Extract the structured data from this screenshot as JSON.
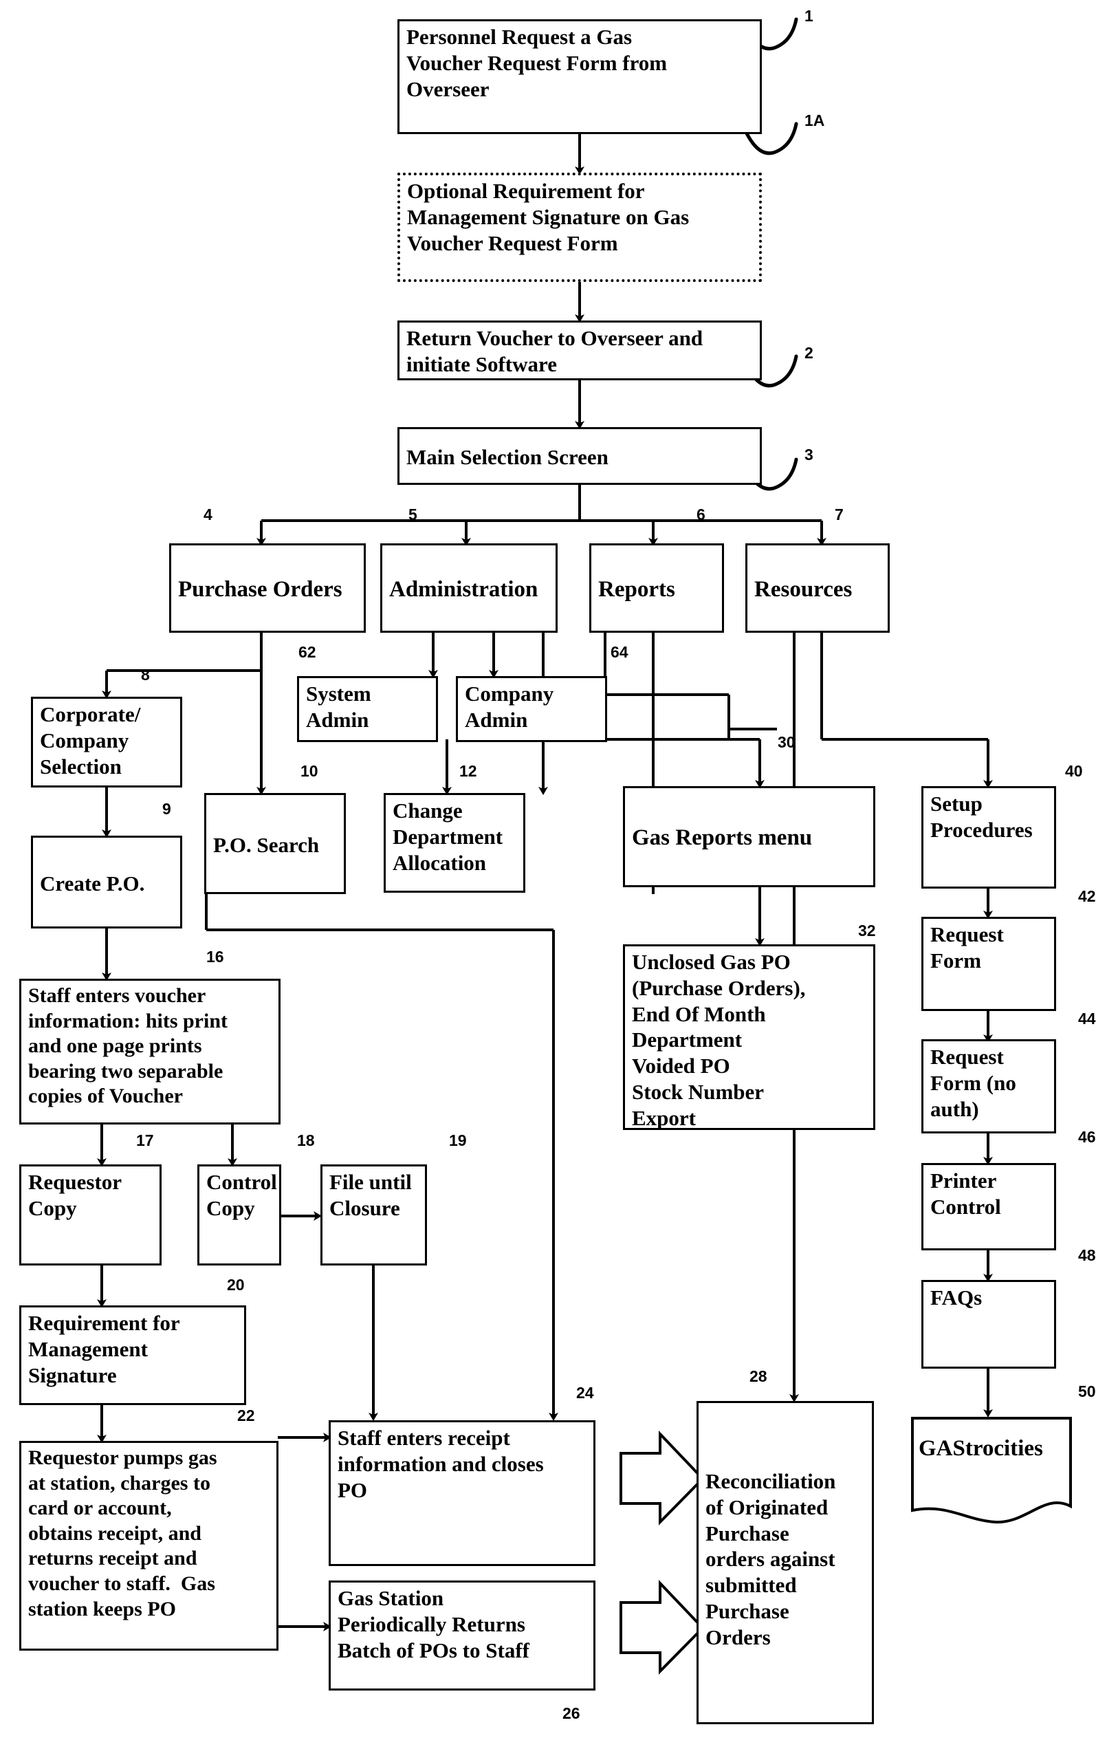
{
  "diagram": {
    "title": "Gas Voucher Purchase Order Process Flowchart",
    "type": "flowchart"
  },
  "nodes": {
    "n1": {
      "label": "Personnel Request a Gas Voucher Request Form from Overseer",
      "ref": "1"
    },
    "n1a": {
      "label": "Optional Requirement for Management Signature on Gas Voucher Request Form",
      "ref": "1A"
    },
    "n2": {
      "label": "Return Voucher to Overseer and initiate Software",
      "ref": "2"
    },
    "n3": {
      "label": "Main Selection Screen",
      "ref": "3"
    },
    "n4": {
      "label": "Purchase Orders",
      "ref": "4"
    },
    "n5": {
      "label": "Administration",
      "ref": "5"
    },
    "n6": {
      "label": "Reports",
      "ref": "6"
    },
    "n7": {
      "label": "Resources",
      "ref": "7"
    },
    "n8": {
      "label": "Corporate/ Company Selection",
      "ref": "8"
    },
    "n9": {
      "label": "Create P.O.",
      "ref": "9"
    },
    "n10": {
      "label": "P.O. Search",
      "ref": "10"
    },
    "n12": {
      "label": "Change Department Allocation",
      "ref": "12"
    },
    "n62": {
      "label": "System Admin",
      "ref": "62"
    },
    "n64": {
      "label": "Company Admin",
      "ref": "64"
    },
    "n16": {
      "label": "Staff enters voucher information: hits print and one page prints bearing two separable copies of Voucher",
      "ref": "16"
    },
    "n17": {
      "label": "Requestor Copy",
      "ref": "17"
    },
    "n18": {
      "label": "Control Copy",
      "ref": "18"
    },
    "n19": {
      "label": "File until Closure",
      "ref": "19"
    },
    "n20": {
      "label": "Requirement for Management Signature",
      "ref": "20"
    },
    "n22": {
      "label": "Requestor pumps gas at station, charges to card or account, obtains receipt, and returns receipt and voucher to staff.  Gas station keeps PO",
      "ref": "22"
    },
    "n24": {
      "label": "Staff enters receipt information and closes PO",
      "ref": "24"
    },
    "n26": {
      "label": "Gas Station Periodically Returns Batch of POs to Staff",
      "ref": "26"
    },
    "n28": {
      "label": "Reconciliation of Originated Purchase orders against submitted Purchase Orders",
      "ref": "28"
    },
    "n30": {
      "label": "Gas Reports menu",
      "ref": "30"
    },
    "n32": {
      "label": "Unclosed Gas PO (Purchase Orders), End Of Month Department Voided PO Stock Number Export",
      "ref": "32"
    },
    "n40": {
      "label": "Setup Procedures",
      "ref": "40"
    },
    "n42": {
      "label": "Request Form",
      "ref": "42"
    },
    "n44": {
      "label": "Request Form (no auth)",
      "ref": "44"
    },
    "n46": {
      "label": "Printer Control",
      "ref": "46"
    },
    "n48": {
      "label": "FAQs",
      "ref": "48"
    },
    "n50": {
      "label": "GAStrocities",
      "ref": "50"
    }
  },
  "node_lines": {
    "n1": [
      "Personnel Request a Gas",
      "Voucher Request Form from",
      "Overseer"
    ],
    "n1a": [
      "Optional Requirement for",
      "Management Signature on Gas",
      "Voucher Request Form"
    ],
    "n2": [
      "Return Voucher to Overseer and",
      "initiate Software"
    ],
    "n3": [
      "Main Selection Screen"
    ],
    "n4": [
      "Purchase Orders"
    ],
    "n5": [
      "Administration"
    ],
    "n6": [
      "Reports"
    ],
    "n7": [
      "Resources"
    ],
    "n8": [
      "Corporate/",
      "Company",
      "Selection"
    ],
    "n9": [
      "Create P.O."
    ],
    "n10": [
      "P.O. Search"
    ],
    "n12": [
      "Change",
      "Department",
      "Allocation"
    ],
    "n62": [
      "System",
      "Admin"
    ],
    "n64": [
      "Company",
      "Admin"
    ],
    "n16": [
      "Staff enters voucher",
      "information: hits print",
      "and one page prints",
      "bearing two separable",
      "copies of Voucher"
    ],
    "n17": [
      "Requestor",
      "Copy"
    ],
    "n18": [
      "Control",
      "Copy"
    ],
    "n19": [
      "File until",
      "Closure"
    ],
    "n20": [
      "Requirement for",
      "Management",
      "Signature"
    ],
    "n22": [
      "Requestor pumps gas",
      "at station, charges to",
      "card or account,",
      "obtains receipt, and",
      "returns receipt and",
      "voucher to staff.  Gas",
      "station keeps PO"
    ],
    "n24": [
      "Staff enters receipt",
      "information and closes",
      "PO"
    ],
    "n26": [
      "Gas Station",
      "Periodically Returns",
      "Batch of POs to Staff"
    ],
    "n28": [
      "Reconciliation",
      "of Originated",
      "Purchase",
      "orders against",
      "submitted",
      "Purchase",
      "Orders"
    ],
    "n30": [
      "Gas Reports menu"
    ],
    "n32": [
      "Unclosed Gas PO",
      "(Purchase Orders),",
      "End Of Month",
      "Department",
      "Voided PO",
      "Stock Number",
      "Export"
    ],
    "n40": [
      "Setup",
      "Procedures"
    ],
    "n42": [
      "Request",
      "Form"
    ],
    "n44": [
      "Request",
      "Form (no",
      "auth)"
    ],
    "n46": [
      "Printer",
      "Control"
    ],
    "n48": [
      "FAQs"
    ],
    "n50": [
      "GAStrocities"
    ]
  },
  "colors": {
    "ink": "#000000",
    "paper": "#ffffff"
  }
}
